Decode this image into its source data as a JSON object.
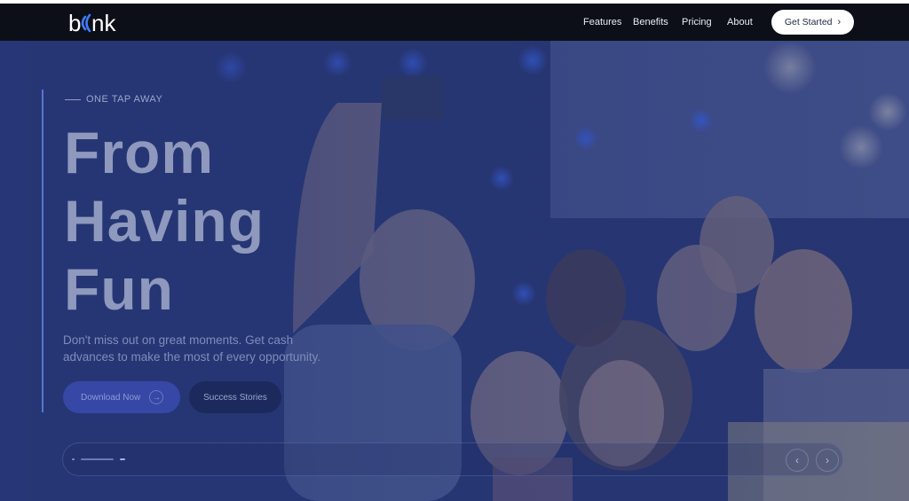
{
  "nav": {
    "logo_text": "blink",
    "links": [
      "Features",
      "Benefits",
      "Pricing",
      "About"
    ],
    "cta_label": "Get Started"
  },
  "hero": {
    "eyebrow": "ONE TAP AWAY",
    "headline": [
      "From",
      "Having",
      "Fun"
    ],
    "subtext": "Don't miss out on great moments. Get cash advances to make the most of every opportunity.",
    "primary_button": "Download Now",
    "secondary_button": "Success Stories"
  },
  "slider": {
    "slide_count": 3,
    "active_index": 1
  },
  "colors": {
    "navbar_bg": "#0c0f18",
    "hero_overlay": "#263678",
    "accent": "#3647a6",
    "logo_accent": "#3f7bff"
  }
}
